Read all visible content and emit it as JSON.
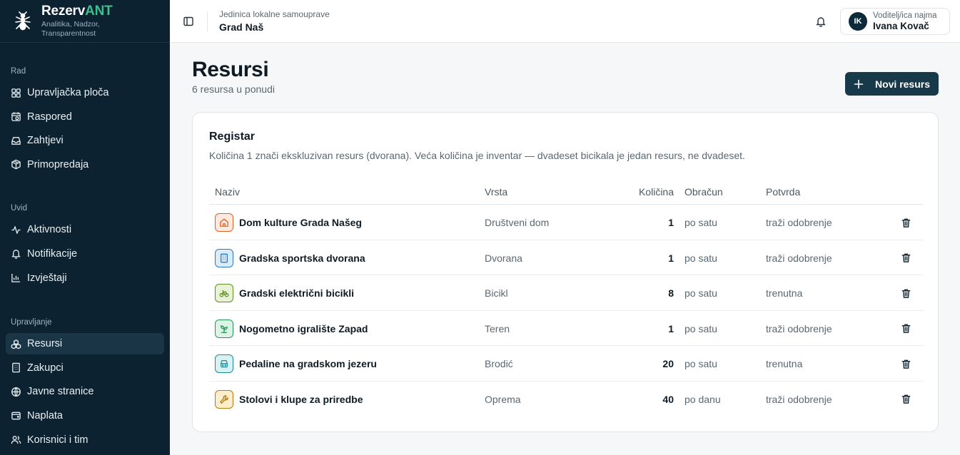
{
  "brand": {
    "name_main": "Rezerv",
    "name_accent": "ANT",
    "tagline": "Analitika, Nadzor, Transparentnost"
  },
  "colors": {
    "sidebar_bg": "#0c2230",
    "accent": "#3fbf8f",
    "primary_button": "#17394a"
  },
  "sidebar": {
    "sections": [
      {
        "heading": "Rad",
        "items": [
          {
            "label": "Upravljačka ploča",
            "icon": "dashboard-grid-icon"
          },
          {
            "label": "Raspored",
            "icon": "calendar-clock-icon"
          },
          {
            "label": "Zahtjevi",
            "icon": "inbox-icon"
          },
          {
            "label": "Primopredaja",
            "icon": "package-icon"
          }
        ]
      },
      {
        "heading": "Uvid",
        "items": [
          {
            "label": "Aktivnosti",
            "icon": "activity-pulse-icon"
          },
          {
            "label": "Notifikacije",
            "icon": "bell-icon"
          },
          {
            "label": "Izvještaji",
            "icon": "bar-chart-icon"
          }
        ]
      },
      {
        "heading": "Upravljanje",
        "items": [
          {
            "label": "Resursi",
            "icon": "boxes-icon",
            "active": true
          },
          {
            "label": "Zakupci",
            "icon": "building-icon"
          },
          {
            "label": "Javne stranice",
            "icon": "globe-icon"
          },
          {
            "label": "Naplata",
            "icon": "wallet-icon"
          },
          {
            "label": "Korisnici i tim",
            "icon": "users-icon"
          }
        ]
      }
    ]
  },
  "header": {
    "context_label": "Jedinica lokalne samouprave",
    "context_value": "Grad Naš",
    "user": {
      "initials": "IK",
      "role": "Voditelj/ica najma",
      "name": "Ivana Kovač"
    }
  },
  "main": {
    "title": "Resursi",
    "subtitle": "6 resursa u ponudi",
    "new_button": "Novi resurs",
    "register": {
      "title": "Registar",
      "description": "Količina 1 znači ekskluzivan resurs (dvorana). Veća količina je inventar — dvadeset bicikala je jedan resurs, ne dvadeset.",
      "columns": [
        "Naziv",
        "Vrsta",
        "Količina",
        "Obračun",
        "Potvrda"
      ],
      "rows": [
        {
          "name": "Dom kulture Grada Našeg",
          "type": "Društveni dom",
          "qty": "1",
          "billing": "po satu",
          "confirmation": "traži odobrenje",
          "icon": "home-icon",
          "icon_color": "#e0632a",
          "icon_bg": "#fde9de"
        },
        {
          "name": "Gradska sportska dvorana",
          "type": "Dvorana",
          "qty": "1",
          "billing": "po satu",
          "confirmation": "traži odobrenje",
          "icon": "building-icon",
          "icon_color": "#2b7cc7",
          "icon_bg": "#dcebf8"
        },
        {
          "name": "Gradski električni bicikli",
          "type": "Bicikl",
          "qty": "8",
          "billing": "po satu",
          "confirmation": "trenutna",
          "icon": "bicycle-icon",
          "icon_color": "#5f8f1f",
          "icon_bg": "#e8f3d6"
        },
        {
          "name": "Nogometno igralište Zapad",
          "type": "Teren",
          "qty": "1",
          "billing": "po satu",
          "confirmation": "traži odobrenje",
          "icon": "sprout-icon",
          "icon_color": "#1f9a58",
          "icon_bg": "#dcf3e5"
        },
        {
          "name": "Pedaline na gradskom jezeru",
          "type": "Brodić",
          "qty": "20",
          "billing": "po satu",
          "confirmation": "trenutna",
          "icon": "boat-icon",
          "icon_color": "#178f9a",
          "icon_bg": "#d8f1f3"
        },
        {
          "name": "Stolovi i klupe za priredbe",
          "type": "Oprema",
          "qty": "40",
          "billing": "po danu",
          "confirmation": "traži odobrenje",
          "icon": "wrench-icon",
          "icon_color": "#b77a0c",
          "icon_bg": "#fbeecd"
        }
      ]
    }
  }
}
